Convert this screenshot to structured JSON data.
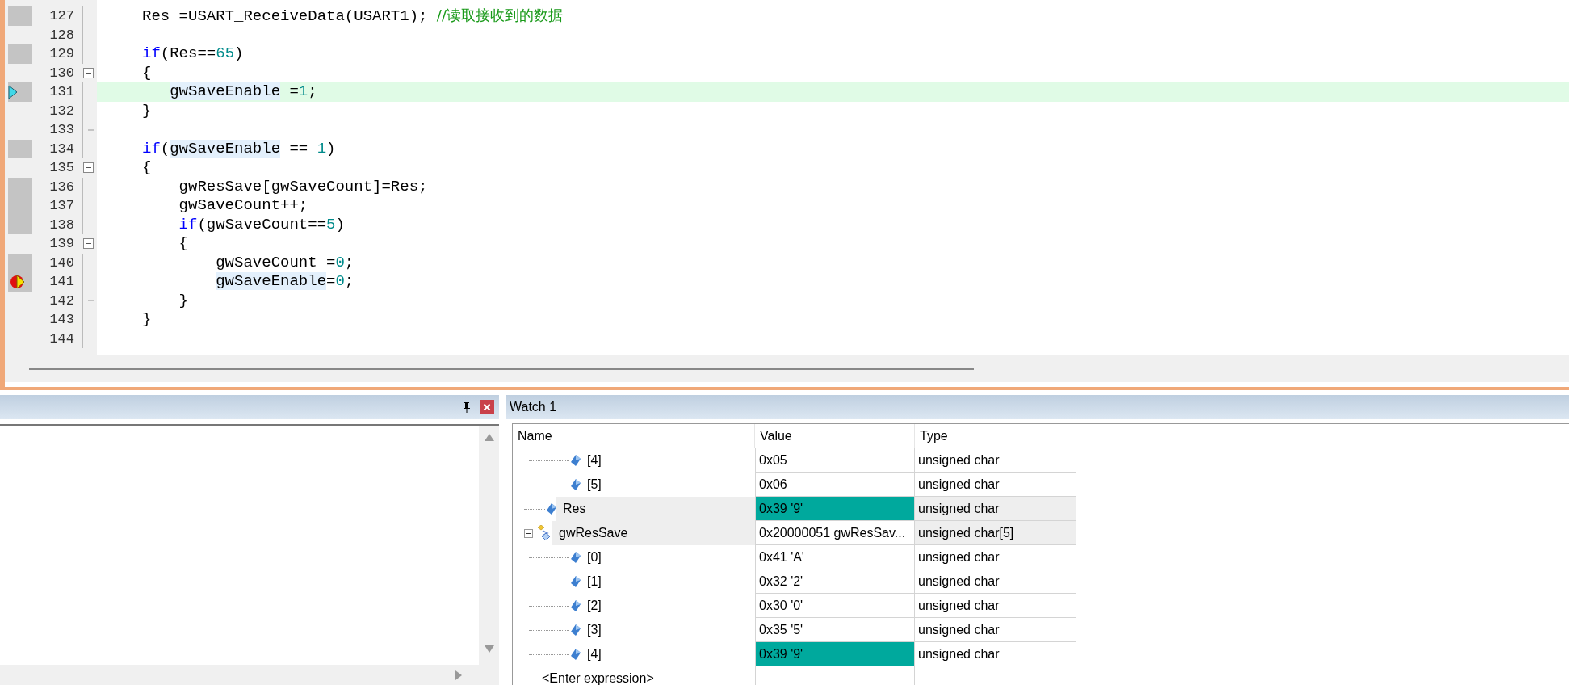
{
  "editor": {
    "lines": [
      {
        "number": "127",
        "executed": true,
        "current": false,
        "breakpoint": false,
        "fold_start": false,
        "fold_end": false,
        "tokens": [
          {
            "text": "Res =USART_ReceiveData(USART1); ",
            "kind": "plain"
          },
          {
            "text": "//读取接收到的数据",
            "kind": "comment"
          }
        ]
      },
      {
        "number": "128",
        "executed": false,
        "current": false,
        "breakpoint": false,
        "fold_start": false,
        "fold_end": false
      },
      {
        "number": "129",
        "executed": true,
        "current": false,
        "breakpoint": false,
        "fold_start": false,
        "fold_end": false,
        "tokens": [
          {
            "text": "if",
            "kind": "keyword"
          },
          {
            "text": "(Res==",
            "kind": "plain"
          },
          {
            "text": "65",
            "kind": "number"
          },
          {
            "text": ")",
            "kind": "plain"
          }
        ]
      },
      {
        "number": "130",
        "executed": false,
        "current": false,
        "breakpoint": false,
        "fold_start": true,
        "fold_end": false,
        "tokens": [
          {
            "text": "{",
            "kind": "plain"
          }
        ]
      },
      {
        "number": "131",
        "executed": true,
        "current": true,
        "breakpoint": false,
        "fold_start": false,
        "fold_end": false,
        "tokens": [
          {
            "text": "   gwSaveEnable",
            "kind": "highlight"
          },
          {
            "text": " =",
            "kind": "plain"
          },
          {
            "text": "1",
            "kind": "number"
          },
          {
            "text": ";",
            "kind": "plain"
          }
        ]
      },
      {
        "number": "132",
        "executed": false,
        "current": false,
        "breakpoint": false,
        "fold_start": false,
        "fold_end": false,
        "tokens": [
          {
            "text": "}",
            "kind": "plain"
          }
        ]
      },
      {
        "number": "133",
        "executed": false,
        "current": false,
        "breakpoint": false,
        "fold_start": false,
        "fold_end": true
      },
      {
        "number": "134",
        "executed": true,
        "current": false,
        "breakpoint": false,
        "fold_start": false,
        "fold_end": false,
        "tokens": [
          {
            "text": "if",
            "kind": "keyword"
          },
          {
            "text": "(",
            "kind": "plain"
          },
          {
            "text": "gwSaveEnable",
            "kind": "highlight"
          },
          {
            "text": " == ",
            "kind": "plain"
          },
          {
            "text": "1",
            "kind": "number"
          },
          {
            "text": ")",
            "kind": "plain"
          }
        ]
      },
      {
        "number": "135",
        "executed": false,
        "current": false,
        "breakpoint": false,
        "fold_start": true,
        "fold_end": false,
        "tokens": [
          {
            "text": "{",
            "kind": "plain"
          }
        ]
      },
      {
        "number": "136",
        "executed": true,
        "current": false,
        "breakpoint": false,
        "fold_start": false,
        "fold_end": false,
        "tokens": [
          {
            "text": "    gwResSave[gwSaveCount]=Res;",
            "kind": "plain"
          }
        ]
      },
      {
        "number": "137",
        "executed": true,
        "current": false,
        "breakpoint": false,
        "fold_start": false,
        "fold_end": false,
        "tokens": [
          {
            "text": "    gwSaveCount++;",
            "kind": "plain"
          }
        ]
      },
      {
        "number": "138",
        "executed": true,
        "current": false,
        "breakpoint": false,
        "fold_start": false,
        "fold_end": false,
        "tokens": [
          {
            "text": "    if",
            "kind": "keyword"
          },
          {
            "text": "(gwSaveCount==",
            "kind": "plain"
          },
          {
            "text": "5",
            "kind": "number"
          },
          {
            "text": ")",
            "kind": "plain"
          }
        ]
      },
      {
        "number": "139",
        "executed": false,
        "current": false,
        "breakpoint": false,
        "fold_start": true,
        "fold_end": false,
        "tokens": [
          {
            "text": "    {",
            "kind": "plain"
          }
        ]
      },
      {
        "number": "140",
        "executed": true,
        "current": false,
        "breakpoint": false,
        "fold_start": false,
        "fold_end": false,
        "tokens": [
          {
            "text": "        gwSaveCount =",
            "kind": "plain"
          },
          {
            "text": "0",
            "kind": "number"
          },
          {
            "text": ";",
            "kind": "plain"
          }
        ]
      },
      {
        "number": "141",
        "executed": true,
        "current": false,
        "breakpoint": true,
        "fold_start": false,
        "fold_end": false,
        "tokens": [
          {
            "text": "        gwSaveEnable",
            "kind": "highlight"
          },
          {
            "text": "=",
            "kind": "plain"
          },
          {
            "text": "0",
            "kind": "number"
          },
          {
            "text": ";",
            "kind": "plain"
          }
        ]
      },
      {
        "number": "142",
        "executed": false,
        "current": false,
        "breakpoint": false,
        "fold_start": false,
        "fold_end": true,
        "tokens": [
          {
            "text": "    }",
            "kind": "plain"
          }
        ]
      },
      {
        "number": "143",
        "executed": false,
        "current": false,
        "breakpoint": false,
        "fold_start": false,
        "fold_end": false,
        "tokens": [
          {
            "text": "}",
            "kind": "plain"
          }
        ]
      },
      {
        "number": "144",
        "executed": false,
        "current": false,
        "breakpoint": false,
        "fold_start": false,
        "fold_end": false
      }
    ]
  },
  "watch": {
    "title": "Watch 1",
    "columns": [
      "Name",
      "Value",
      "Type"
    ],
    "rows": [
      {
        "children": [
          {
            "name": "[4]",
            "value": "0x05",
            "type": "unsigned char",
            "kind": "variable",
            "changed": false
          },
          {
            "name": "[5]",
            "value": "0x06",
            "type": "unsigned char",
            "kind": "variable",
            "changed": false
          }
        ]
      },
      {
        "name": "Res",
        "value": "0x39 '9'",
        "type": "unsigned char",
        "kind": "variable",
        "changed": true
      },
      {
        "name": "gwResSave",
        "value": "0x20000051 gwResSav...",
        "type": "unsigned char[5]",
        "kind": "array",
        "changed": false,
        "expanded": true,
        "children": [
          {
            "name": "[0]",
            "value": "0x41 'A'",
            "type": "unsigned char",
            "kind": "variable",
            "changed": false
          },
          {
            "name": "[1]",
            "value": "0x32 '2'",
            "type": "unsigned char",
            "kind": "variable",
            "changed": false
          },
          {
            "name": "[2]",
            "value": "0x30 '0'",
            "type": "unsigned char",
            "kind": "variable",
            "changed": false
          },
          {
            "name": "[3]",
            "value": "0x35 '5'",
            "type": "unsigned char",
            "kind": "variable",
            "changed": false
          },
          {
            "name": "[4]",
            "value": "0x39 '9'",
            "type": "unsigned char",
            "kind": "variable",
            "changed": true
          }
        ]
      }
    ],
    "entry_placeholder": "<Enter expression>"
  }
}
